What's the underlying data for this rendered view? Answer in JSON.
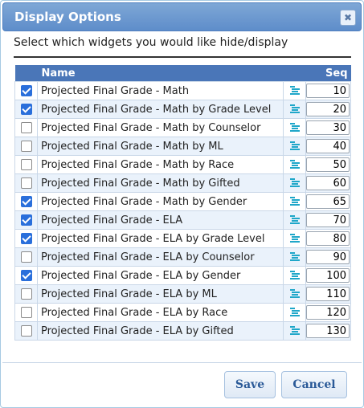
{
  "dialog": {
    "title": "Display Options",
    "close_glyph": "✖",
    "instruction": "Select which widgets you would like hide/display"
  },
  "table": {
    "headers": {
      "name": "Name",
      "seq": "Seq"
    },
    "rows": [
      {
        "checked": true,
        "name": "Projected Final Grade - Math",
        "seq": "10"
      },
      {
        "checked": true,
        "name": "Projected Final Grade - Math by Grade Level",
        "seq": "20"
      },
      {
        "checked": false,
        "name": "Projected Final Grade - Math by Counselor",
        "seq": "30"
      },
      {
        "checked": false,
        "name": "Projected Final Grade - Math by ML",
        "seq": "40"
      },
      {
        "checked": false,
        "name": "Projected Final Grade - Math by Race",
        "seq": "50"
      },
      {
        "checked": false,
        "name": "Projected Final Grade - Math by Gifted",
        "seq": "60"
      },
      {
        "checked": true,
        "name": "Projected Final Grade - Math by Gender",
        "seq": "65"
      },
      {
        "checked": true,
        "name": "Projected Final Grade - ELA",
        "seq": "70"
      },
      {
        "checked": true,
        "name": "Projected Final Grade - ELA by Grade Level",
        "seq": "80"
      },
      {
        "checked": false,
        "name": "Projected Final Grade - ELA by Counselor",
        "seq": "90"
      },
      {
        "checked": true,
        "name": "Projected Final Grade - ELA by Gender",
        "seq": "100"
      },
      {
        "checked": false,
        "name": "Projected Final Grade - ELA by ML",
        "seq": "110"
      },
      {
        "checked": false,
        "name": "Projected Final Grade - ELA by Race",
        "seq": "120"
      },
      {
        "checked": false,
        "name": "Projected Final Grade - ELA by Gifted",
        "seq": "130"
      }
    ],
    "handle_icon": "drag-handle-icon"
  },
  "buttons": {
    "save": "Save",
    "cancel": "Cancel"
  },
  "colors": {
    "title_bar": "#5e8dca",
    "header": "#4a76b8",
    "checked": "#2a6fdb",
    "handle": "#1fa7c9",
    "button_text": "#2b5a98"
  }
}
